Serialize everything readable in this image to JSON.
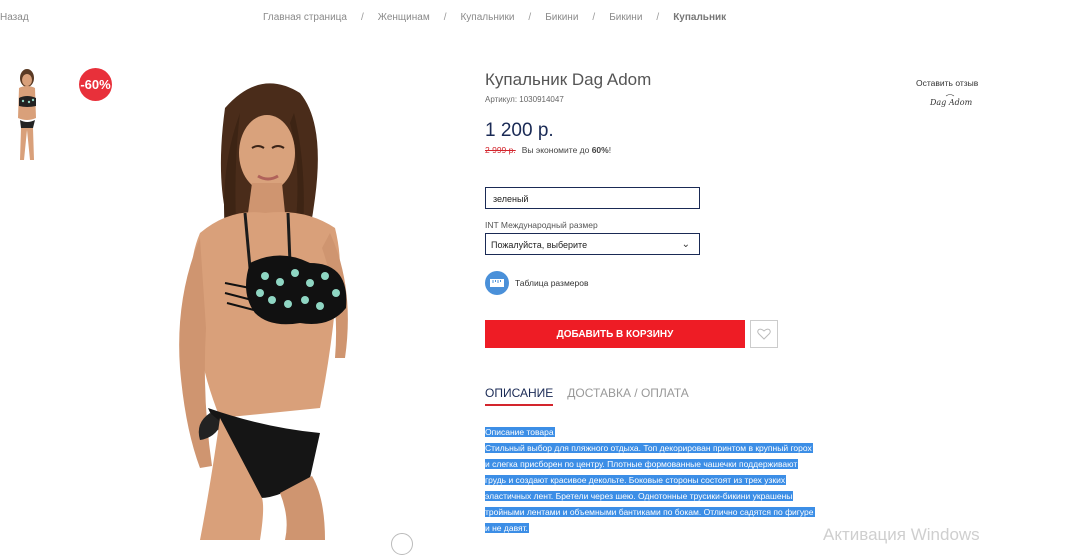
{
  "nav": {
    "back": "Назад",
    "breadcrumbs": [
      "Главная страница",
      "Женщинам",
      "Купальники",
      "Бикини",
      "Бикини",
      "Купальник"
    ],
    "separator": "/"
  },
  "gallery": {
    "discount_badge": "-60%"
  },
  "product": {
    "title": "Купальник Dag Adom",
    "sku": "Артикул: 1030914047",
    "price": "1 200 р.",
    "old_price": "2 999 р.",
    "savings_prefix": "Вы экономите до ",
    "savings_value": "60%",
    "savings_suffix": "!"
  },
  "review": {
    "label": "Оставить отзыв",
    "brand_logo": "Dag Adom"
  },
  "options": {
    "color_value": "зеленый",
    "size_label": "INT Международный размер",
    "size_value": "Пожалуйста, выберите",
    "size_table": "Таблица размеров"
  },
  "actions": {
    "add_to_cart": "ДОБАВИТЬ В КОРЗИНУ",
    "wishlist_icon": "heart-icon"
  },
  "tabs": [
    {
      "label": "ОПИСАНИЕ",
      "active": true
    },
    {
      "label": "ДОСТАВКА / ОПЛАТА",
      "active": false
    }
  ],
  "description": {
    "heading": "Описание товара",
    "lines": [
      "Стильный выбор для пляжного отдыха. Топ декорирован принтом в крупный горох",
      "и слегка присборен по центру. Плотные формованные чашечки поддерживают",
      "грудь и создают красивое декольте. Боковые стороны состоят из трех узких",
      "эластичных лент. Бретели через шею. Однотонные трусики-бикини украшены",
      "тройными лентами и объемными бантиками по бокам. Отлично садятся по фигуре",
      "и не давят."
    ]
  },
  "watermark": "Активация Windows",
  "colors": {
    "accent_red": "#ee1c25",
    "navy": "#1a2a55",
    "selection": "#3c8ee6"
  }
}
